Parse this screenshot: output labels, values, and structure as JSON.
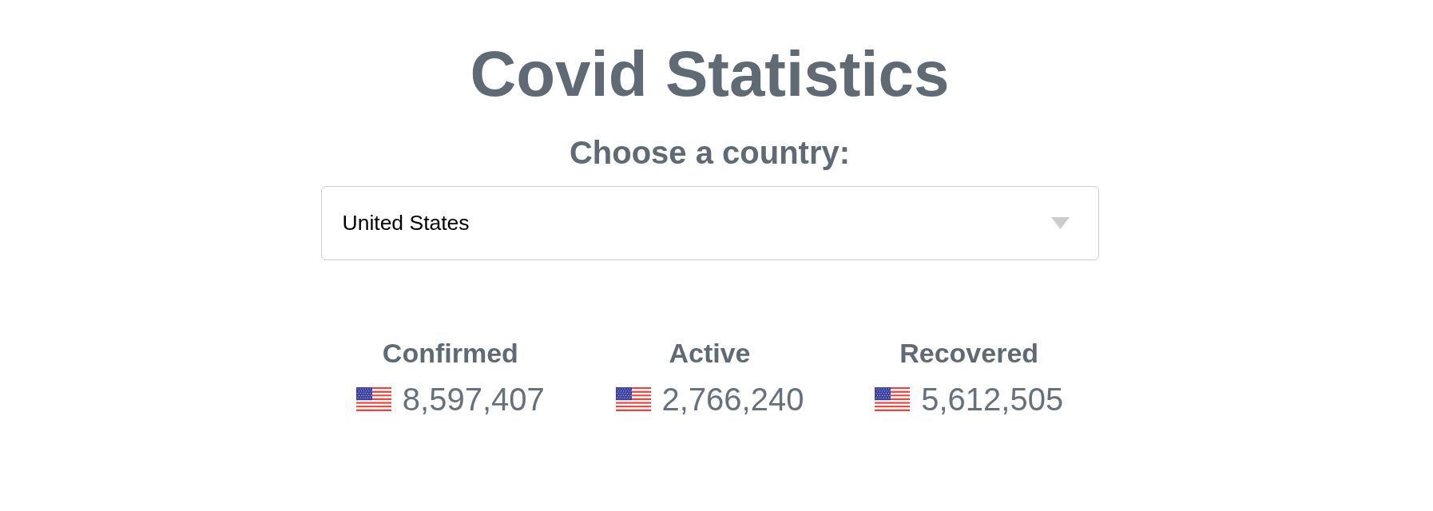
{
  "title": "Covid Statistics",
  "country_picker": {
    "label": "Choose a country:",
    "value": "United States"
  },
  "stats": [
    {
      "label": "Confirmed",
      "value": "8,597,407"
    },
    {
      "label": "Active",
      "value": "2,766,240"
    },
    {
      "label": "Recovered",
      "value": "5,612,505"
    }
  ]
}
